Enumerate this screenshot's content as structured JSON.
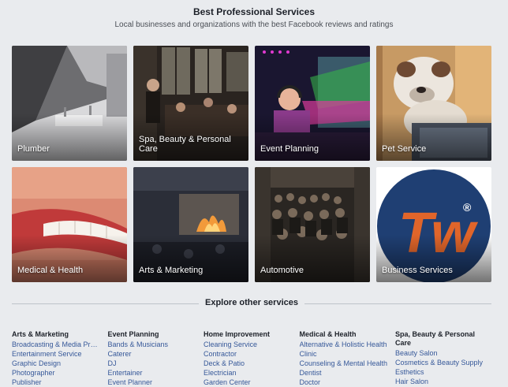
{
  "header": {
    "title": "Best Professional Services",
    "subtitle": "Local businesses and organizations with the best Facebook reviews and ratings"
  },
  "tiles": [
    {
      "label": "Plumber"
    },
    {
      "label": "Spa, Beauty & Personal Care"
    },
    {
      "label": "Event Planning"
    },
    {
      "label": "Pet Service"
    },
    {
      "label": "Medical & Health"
    },
    {
      "label": "Arts & Marketing"
    },
    {
      "label": "Automotive"
    },
    {
      "label": "Business Services"
    }
  ],
  "explore": {
    "heading": "Explore other services",
    "columns": [
      {
        "title": "Arts & Marketing",
        "links": [
          "Broadcasting & Media Produ...",
          "Entertainment Service",
          "Graphic Design",
          "Photographer",
          "Publisher"
        ]
      },
      {
        "title": "Event Planning",
        "links": [
          "Bands & Musicians",
          "Caterer",
          "DJ",
          "Entertainer",
          "Event Planner"
        ]
      },
      {
        "title": "Home Improvement",
        "links": [
          "Cleaning Service",
          "Contractor",
          "Deck & Patio",
          "Electrician",
          "Garden Center"
        ]
      },
      {
        "title": "Medical & Health",
        "links": [
          "Alternative & Holistic Health",
          "Clinic",
          "Counseling & Mental Health",
          "Dentist",
          "Doctor"
        ]
      },
      {
        "title": "Spa, Beauty & Personal Care",
        "links": [
          "Beauty Salon",
          "Cosmetics & Beauty Supply",
          "Esthetics",
          "Hair Salon"
        ]
      }
    ]
  },
  "logo": {
    "text": "Tw",
    "mark": "®"
  },
  "colors": {
    "background": "#e9ebee",
    "link": "#365899",
    "logo_blue": "#1f3f73",
    "logo_orange": "#e0652a"
  }
}
